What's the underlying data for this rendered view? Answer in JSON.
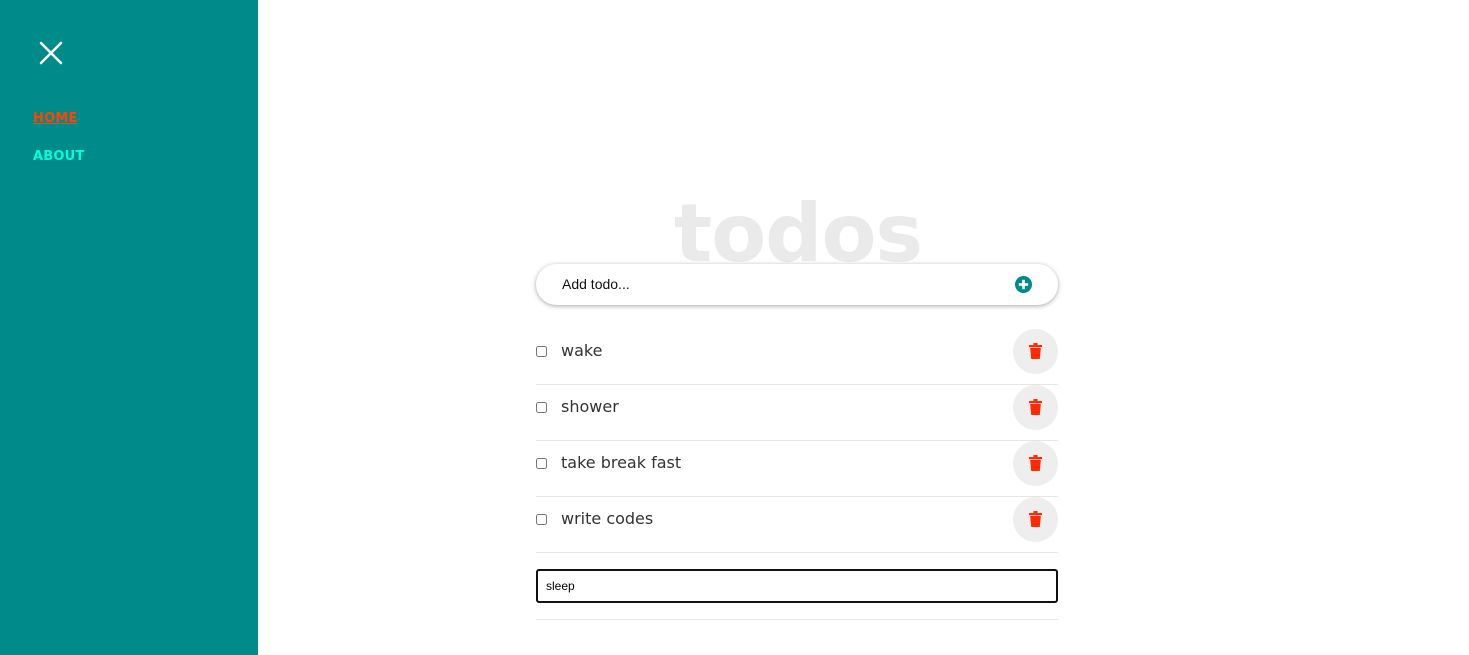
{
  "colors": {
    "sidebar_bg": "#008b8b",
    "nav_active": "#ff4500",
    "nav_inactive": "#00ffd5",
    "title": "#eaeaea",
    "add_icon": "#008b8b",
    "delete_icon": "#ff2a00"
  },
  "sidebar": {
    "close_icon": "close-icon",
    "nav": [
      {
        "label": "HOME",
        "active": true
      },
      {
        "label": "ABOUT",
        "active": false
      }
    ]
  },
  "main": {
    "title": "todos",
    "add_todo": {
      "placeholder": "Add todo...",
      "icon": "plus-circle-icon"
    },
    "todos": [
      {
        "text": "wake",
        "checked": false
      },
      {
        "text": "shower",
        "checked": false
      },
      {
        "text": "take break fast",
        "checked": false
      },
      {
        "text": "write codes",
        "checked": false
      }
    ],
    "edit_input": {
      "value": "sleep"
    },
    "delete_icon": "trash-icon"
  }
}
